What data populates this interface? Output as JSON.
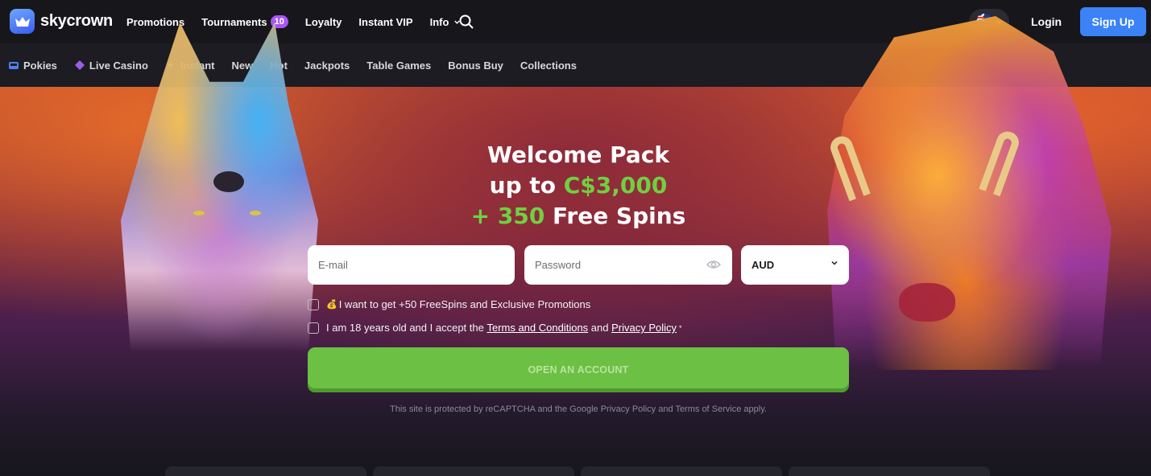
{
  "brand": {
    "name": "skycrown",
    "accent": "#3b82f6",
    "green": "#6cc043"
  },
  "topnav": {
    "items": [
      {
        "label": "Promotions"
      },
      {
        "label": "Tournaments",
        "badge": "10"
      },
      {
        "label": "Loyalty"
      },
      {
        "label": "Instant VIP"
      },
      {
        "label": "Info",
        "icon": "chevron-down-icon"
      }
    ],
    "search_icon": "search-icon",
    "locale_icon": "australia-flag-icon",
    "login_label": "Login",
    "signup_label": "Sign Up"
  },
  "categories": [
    {
      "label": "Pokies",
      "icon": "slot-machine-icon"
    },
    {
      "label": "Live Casino",
      "icon": "spade-icon"
    },
    {
      "label": "Instant",
      "icon": "lightning-icon"
    },
    {
      "label": "New"
    },
    {
      "label": "Hot"
    },
    {
      "label": "Jackpots"
    },
    {
      "label": "Table Games"
    },
    {
      "label": "Bonus Buy"
    },
    {
      "label": "Collections"
    }
  ],
  "hero": {
    "line1": "Welcome Pack",
    "line2_prefix": "up to ",
    "line2_amount": "C$3,000",
    "line3_prefix": "+ 350",
    "line3_suffix": " Free Spins"
  },
  "form": {
    "email_placeholder": "E-mail",
    "password_placeholder": "Password",
    "currency_value": "AUD",
    "promo_text": "I want to get +50 FreeSpins and Exclusive Promotions",
    "age_text_prefix": "I am 18 years old and I accept the ",
    "terms_link": "Terms and Conditions",
    "and_text": " and ",
    "privacy_link": "Privacy Policy",
    "required_mark": "*",
    "submit_label": "OPEN AN ACCOUNT",
    "recaptcha_text": "This site is protected by reCAPTCHA and the Google Privacy Policy and Terms of Service apply."
  }
}
